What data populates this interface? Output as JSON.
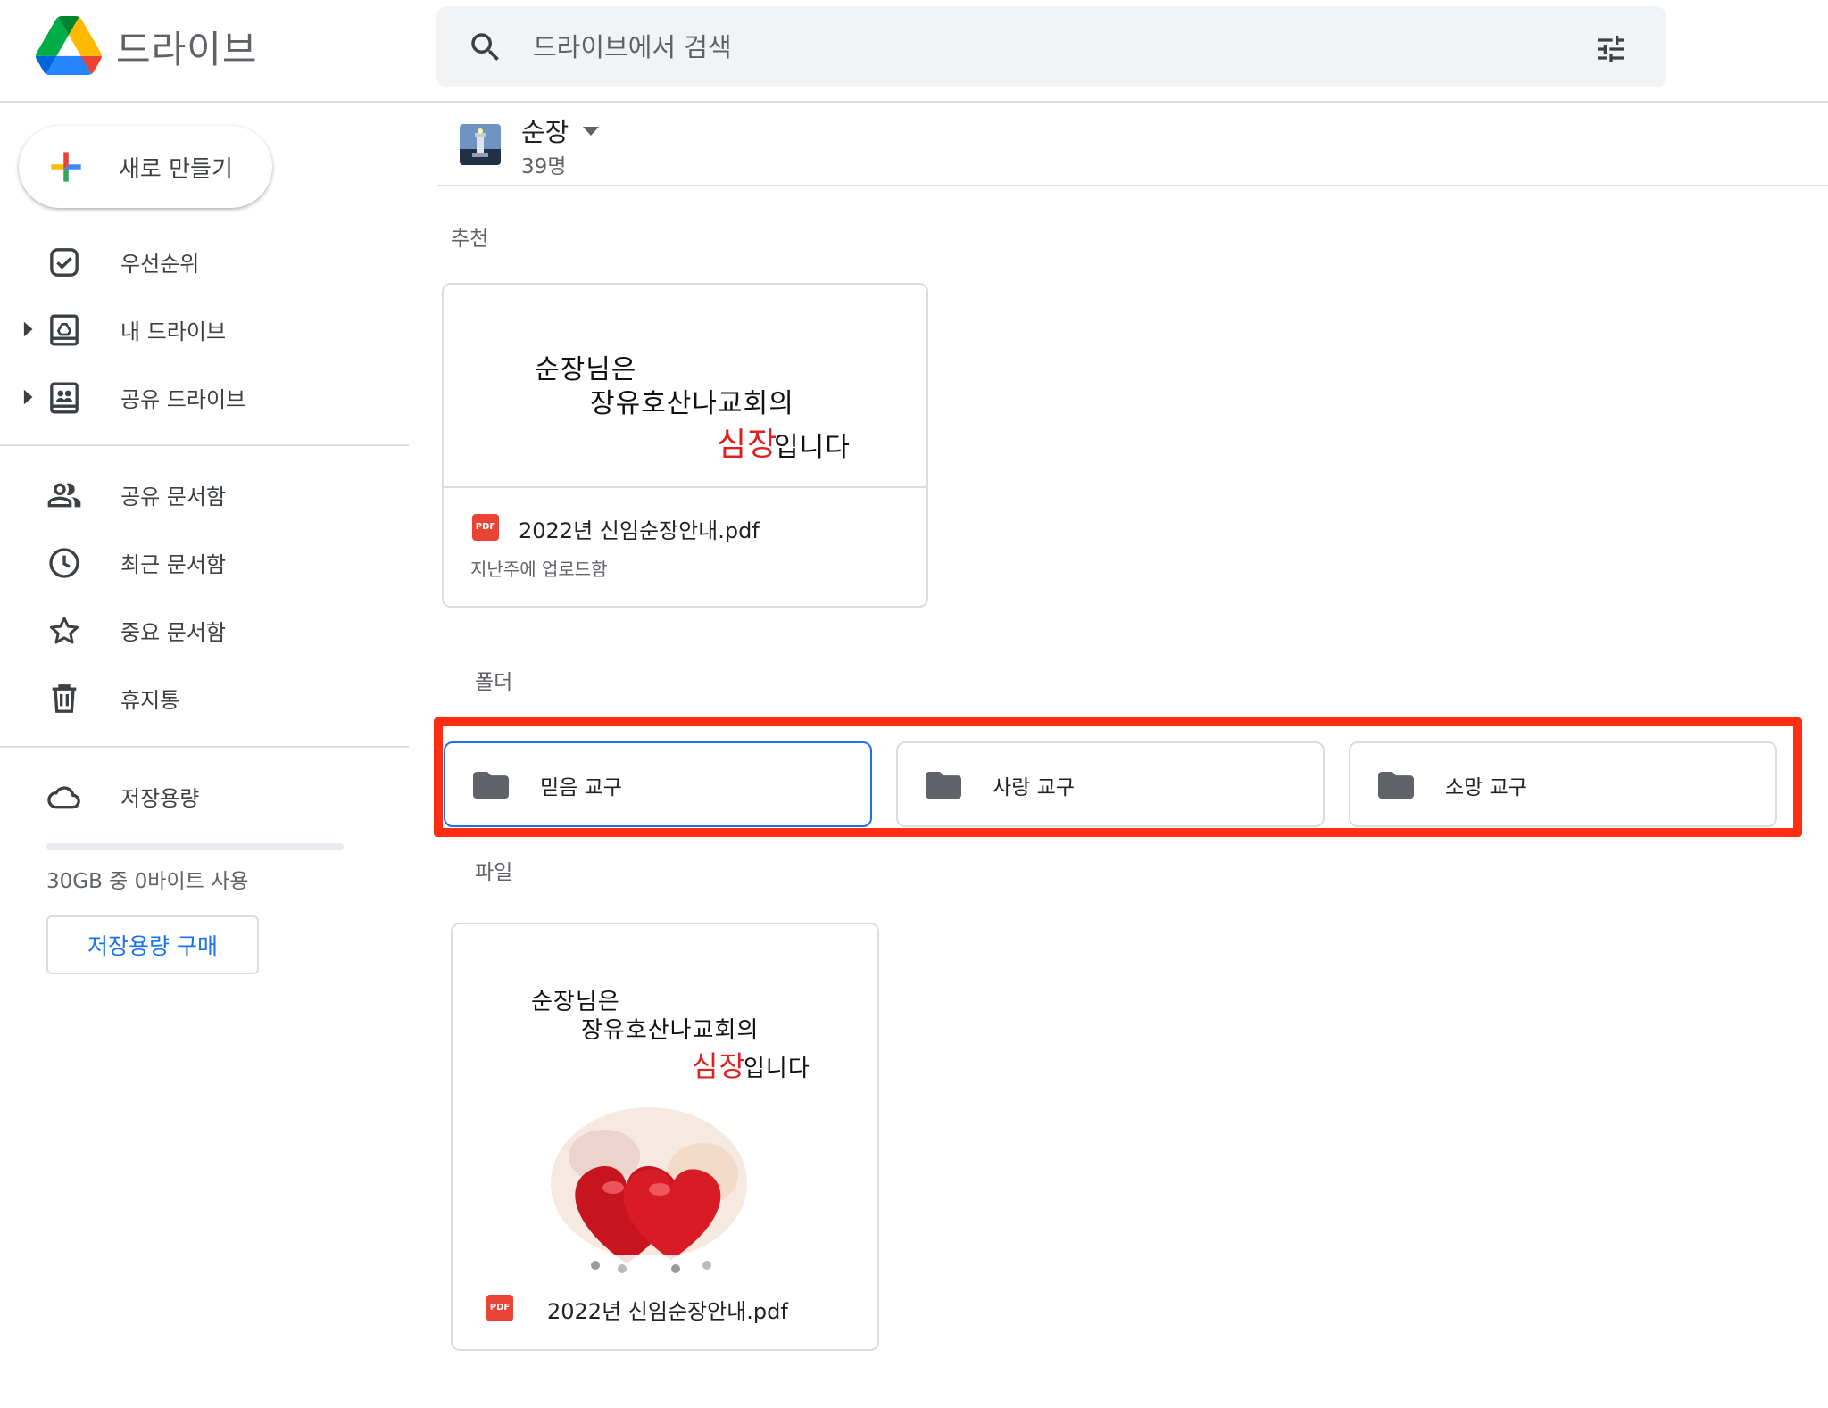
{
  "app": {
    "title": "드라이브"
  },
  "search": {
    "placeholder": "드라이브에서 검색"
  },
  "sidebar": {
    "new_button": "새로 만들기",
    "items": [
      {
        "label": "우선순위",
        "icon": "priority-check-icon"
      },
      {
        "label": "내 드라이브",
        "icon": "my-drive-icon"
      },
      {
        "label": "공유 드라이브",
        "icon": "shared-drives-icon"
      },
      {
        "label": "공유 문서함",
        "icon": "people-icon"
      },
      {
        "label": "최근 문서함",
        "icon": "clock-icon"
      },
      {
        "label": "중요 문서함",
        "icon": "star-icon"
      },
      {
        "label": "휴지통",
        "icon": "trash-icon"
      },
      {
        "label": "저장용량",
        "icon": "cloud-icon"
      }
    ],
    "storage": {
      "used_fraction": 0,
      "text": "30GB 중 0바이트 사용",
      "buy_label": "저장용량 구매"
    }
  },
  "drive": {
    "name": "순장",
    "members": "39명"
  },
  "sections": {
    "suggested": "추천",
    "folders": "폴더",
    "files": "파일"
  },
  "suggested_file": {
    "preview_lines": [
      "순장님은",
      "장유호산나교회의",
      "심장",
      "입니다"
    ],
    "badge": "PDF",
    "name": "2022년 신임순장안내.pdf",
    "meta": "지난주에 업로드함"
  },
  "folders": [
    {
      "label": "믿음 교구"
    },
    {
      "label": "사랑 교구"
    },
    {
      "label": "소망 교구"
    }
  ],
  "file": {
    "preview_lines": [
      "순장님은",
      "장유호산나교회의",
      "심장",
      "입니다"
    ],
    "badge": "PDF",
    "name": "2022년 신임순장안내.pdf"
  },
  "colors": {
    "accent": "#1a73e8",
    "highlight": "#ff2d12",
    "pdf": "#ea4335"
  }
}
